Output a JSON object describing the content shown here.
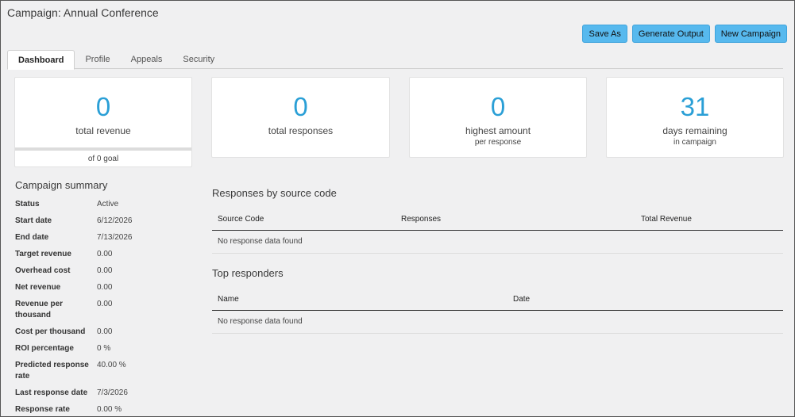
{
  "page": {
    "title": "Campaign: Annual Conference"
  },
  "toolbar": {
    "save_as": "Save As",
    "generate_output": "Generate Output",
    "new_campaign": "New Campaign"
  },
  "tabs": [
    {
      "label": "Dashboard",
      "active": true
    },
    {
      "label": "Profile"
    },
    {
      "label": "Appeals"
    },
    {
      "label": "Security"
    }
  ],
  "cards": {
    "revenue": {
      "value": "0",
      "label": "total revenue",
      "goal": "of 0 goal"
    },
    "responses": {
      "value": "0",
      "label": "total responses"
    },
    "highest": {
      "value": "0",
      "label": "highest amount",
      "sub": "per response"
    },
    "days": {
      "value": "31",
      "label": "days remaining",
      "sub": "in campaign"
    }
  },
  "summary": {
    "title": "Campaign summary",
    "rows": [
      {
        "key": "Status",
        "value": "Active"
      },
      {
        "key": "Start date",
        "value": "6/12/2026"
      },
      {
        "key": "End date",
        "value": "7/13/2026"
      },
      {
        "key": "Target revenue",
        "value": "0.00"
      },
      {
        "key": "Overhead cost",
        "value": "0.00"
      },
      {
        "key": "Net revenue",
        "value": "0.00"
      },
      {
        "key": "Revenue per thousand",
        "value": "0.00"
      },
      {
        "key": "Cost per thousand",
        "value": "0.00"
      },
      {
        "key": "ROI percentage",
        "value": "0 %"
      },
      {
        "key": "Predicted response rate",
        "value": "40.00 %"
      },
      {
        "key": "Last response date",
        "value": "7/3/2026"
      },
      {
        "key": "Response rate",
        "value": "0.00 %"
      }
    ]
  },
  "source_codes": {
    "title": "Responses by source code",
    "columns": [
      "Source Code",
      "Responses",
      "Total Revenue"
    ],
    "empty": "No response data found"
  },
  "top_responders": {
    "title": "Top responders",
    "columns": [
      "Name",
      "Date"
    ],
    "empty": "No response data found"
  }
}
